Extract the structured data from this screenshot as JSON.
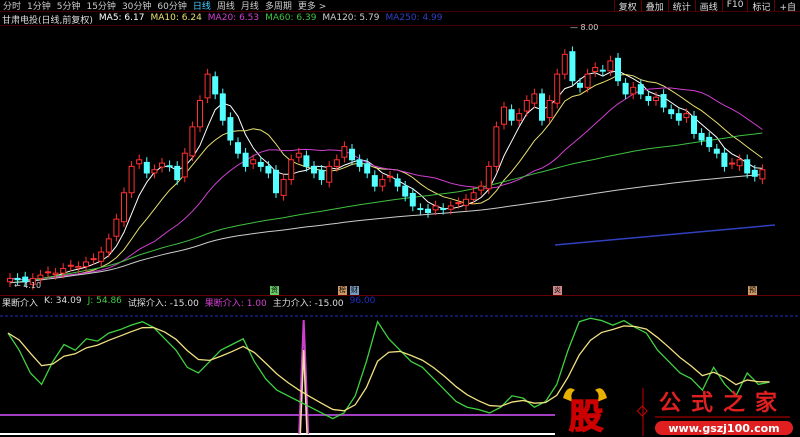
{
  "toolbar": {
    "periods": [
      "分时",
      "1分钟",
      "5分钟",
      "15分钟",
      "30分钟",
      "60分钟",
      "日线",
      "周线",
      "月线",
      "多周期",
      "更多 >"
    ],
    "active": "日线",
    "right": [
      "复权",
      "叠加",
      "统计",
      "画线",
      "F10",
      "标记",
      "+自"
    ]
  },
  "ma_legend": {
    "title": "甘肃电投(日线,前复权)",
    "items": [
      {
        "label": "MA5: 6.17",
        "color": "#ffffff"
      },
      {
        "label": "MA10: 6.24",
        "color": "#e8e070"
      },
      {
        "label": "MA20: 6.53",
        "color": "#d040d0"
      },
      {
        "label": "MA60: 6.39",
        "color": "#40c040"
      },
      {
        "label": "MA120: 5.79",
        "color": "#cccccc"
      },
      {
        "label": "MA250: 4.99",
        "color": "#3040c0"
      }
    ]
  },
  "price_labels": {
    "high": "8.00",
    "low": "4.10"
  },
  "events": [
    {
      "t": "资",
      "color": "#6c6"
    },
    {
      "t": "榜",
      "color": "#c96"
    },
    {
      "t": "财",
      "color": "#79b"
    },
    {
      "t": "炎",
      "color": "#c88"
    },
    {
      "t": "预",
      "color": "#c96"
    }
  ],
  "indicator_legend": [
    {
      "label": "果断介入",
      "color": "#ddd"
    },
    {
      "label": "K: 34.09",
      "color": "#ddd"
    },
    {
      "label": "J: 54.86",
      "color": "#4c4"
    },
    {
      "label": "试探介入: -15.00",
      "color": "#ddd"
    },
    {
      "label": "果断介入: 1.00",
      "color": "#d040d0"
    },
    {
      "label": "主力介入: -15.00",
      "color": "#ddd"
    },
    {
      "label": "96.00",
      "color": "#2030c0"
    }
  ],
  "logo": {
    "char": "股",
    "name": "公式之家",
    "url": "www.gszj100.com"
  },
  "chart_data": {
    "type": "candlestick",
    "ylim": [
      4.1,
      8.0
    ],
    "closes": [
      4.2,
      4.18,
      4.15,
      4.2,
      4.25,
      4.3,
      4.28,
      4.35,
      4.4,
      4.38,
      4.45,
      4.5,
      4.6,
      4.8,
      5.1,
      5.5,
      5.9,
      6.0,
      5.8,
      5.85,
      5.95,
      5.9,
      5.7,
      6.1,
      6.5,
      6.9,
      7.3,
      7.0,
      6.6,
      6.3,
      6.1,
      5.9,
      6.0,
      5.9,
      5.8,
      5.5,
      5.7,
      6.0,
      6.1,
      5.9,
      5.8,
      5.7,
      5.9,
      6.0,
      6.2,
      6.0,
      5.9,
      5.8,
      5.6,
      5.7,
      5.75,
      5.6,
      5.45,
      5.3,
      5.25,
      5.2,
      5.3,
      5.25,
      5.3,
      5.35,
      5.4,
      5.5,
      5.6,
      5.9,
      6.5,
      6.8,
      6.6,
      6.7,
      6.9,
      7.0,
      6.6,
      6.9,
      7.3,
      7.6,
      7.2,
      7.1,
      7.3,
      7.4,
      7.35,
      7.5,
      7.2,
      7.0,
      7.1,
      7.0,
      6.9,
      6.95,
      6.8,
      6.7,
      6.6,
      6.7,
      6.4,
      6.3,
      6.2,
      6.1,
      5.9,
      5.95,
      6.0,
      5.8,
      5.75,
      5.85
    ],
    "k": [
      85,
      70,
      50,
      40,
      60,
      75,
      70,
      80,
      78,
      85,
      88,
      92,
      95,
      90,
      80,
      70,
      55,
      50,
      60,
      70,
      75,
      80,
      60,
      45,
      35,
      30,
      25,
      20,
      15,
      10,
      15,
      30,
      60,
      95,
      80,
      70,
      60,
      55,
      45,
      35,
      25,
      20,
      18,
      15,
      20,
      30,
      28,
      20,
      25,
      40,
      70,
      95,
      98,
      96,
      92,
      96,
      90,
      85,
      70,
      60,
      50,
      45,
      35,
      55,
      40,
      30,
      50,
      40,
      42
    ]
  }
}
